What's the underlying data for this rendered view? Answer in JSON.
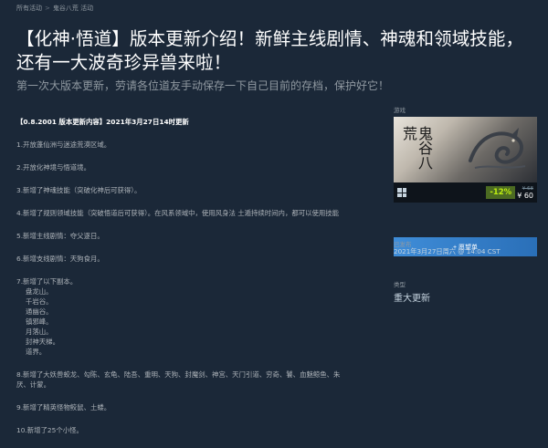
{
  "breadcrumb": [
    "所有活动",
    "鬼谷八荒 活动"
  ],
  "title": "【化神·悟道】版本更新介绍！新鲜主线剧情、神魂和领域技能，还有一大波奇珍异兽来啦！",
  "subtitle": "第一次大版本更新，劳请各位道友手动保存一下自己目前的存档，保护好它！",
  "content": {
    "heading": "【0.8.2001 版本更新内容】2021年3月27日14时更新",
    "items": [
      "1.开放蓬仙洲与迷途荒漠区域。",
      "2.开放化神境与悟道境。",
      "3.新增了神魂技能（突破化神后可获得）。",
      "4.新增了规则领域技能（突破悟道后可获得）。在风系领域中，使用风身法 土遁持续时间内，都可以使用技能",
      "5.新增主线剧情：夺父逐日。",
      "6.新增支线剧情：天狗食月。"
    ],
    "item7_title": "7.新增了以下副本。",
    "item7_list": [
      "盘龙山。",
      "千岩谷。",
      "通幽谷。",
      "镇邪峰。",
      "月落山。",
      "封神天梯。",
      "道界。"
    ],
    "item8": [
      "8.新增了大妖兽蛟龙、勾陈、玄龟、陆吾、重明、天狗、封魔剑、神宫、天门引道、穷奇、饕、血魅鲸鱼、朱",
      "厌、计蒙。"
    ],
    "item9": "9.新增了精英怪物鲛鼠、土蝼。",
    "item10": "10.新增了25个小怪。"
  },
  "sidebar": {
    "game_label": "游戏",
    "game_logo": "鬼谷八荒",
    "discount": "-12%",
    "original_price": "¥ 68",
    "final_price": "¥ 60",
    "wishlist_label": "+ 愿望单",
    "posted_label": "已发布",
    "posted_value": "2021年3月27日周六 @ 14:04 CST",
    "type_label": "类型",
    "type_value": "重大更新"
  }
}
